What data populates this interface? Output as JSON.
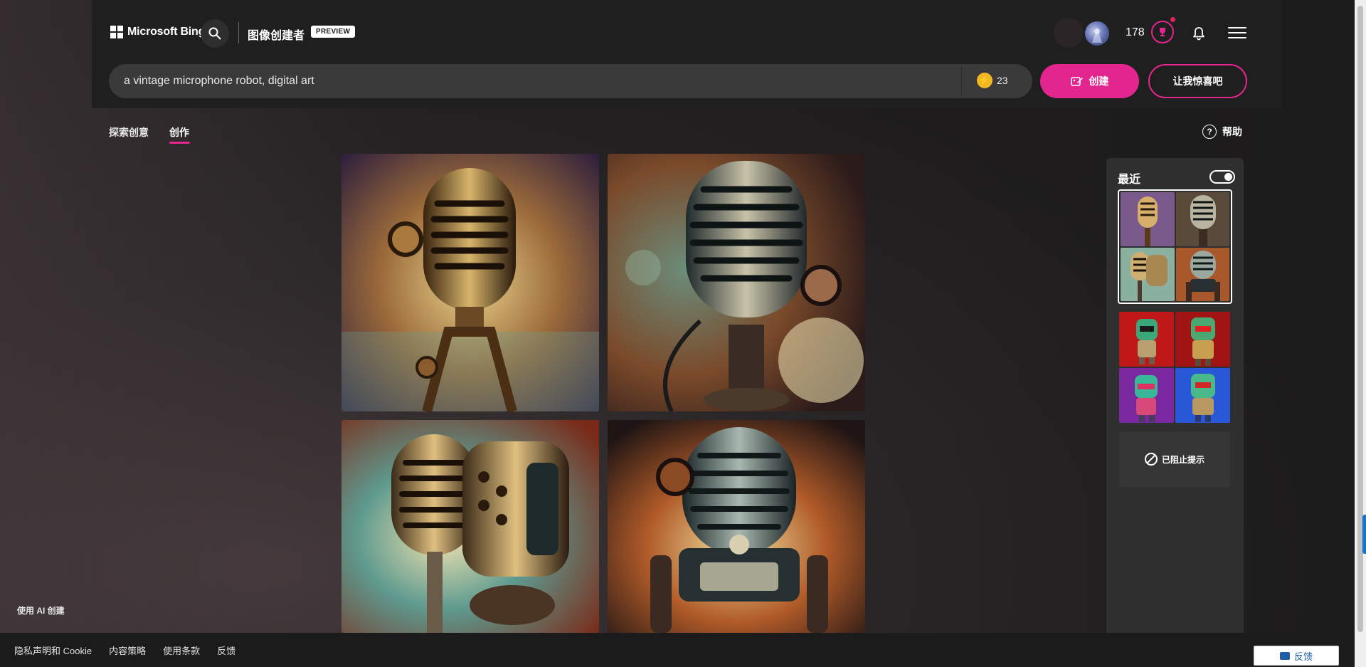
{
  "header": {
    "brand": "Microsoft Bing",
    "app_title": "图像创建者",
    "badge": "PREVIEW",
    "points": "178"
  },
  "prompt": {
    "value": "a vintage microphone robot, digital art",
    "boosts": "23",
    "create_label": "创建",
    "surprise_label": "让我惊喜吧"
  },
  "tabs": {
    "explore": "探索创意",
    "create": "创作",
    "help": "帮助"
  },
  "recent": {
    "title": "最近",
    "blocked_label": "已阻止提示"
  },
  "footer": {
    "ai_note": "使用 AI 创建",
    "links": [
      "隐私声明和 Cookie",
      "内容策略",
      "使用条款",
      "反馈"
    ],
    "feedback_button": "反馈"
  },
  "colors": {
    "accent": "#e3268f",
    "header_bg": "#1f1f1f",
    "boost_coin": "#f2b824"
  },
  "icons": {
    "search": "search-icon",
    "rewards": "trophy-icon",
    "notifications": "bell-icon",
    "menu": "hamburger-menu-icon",
    "help": "question-icon",
    "blocked": "prohibited-icon"
  }
}
